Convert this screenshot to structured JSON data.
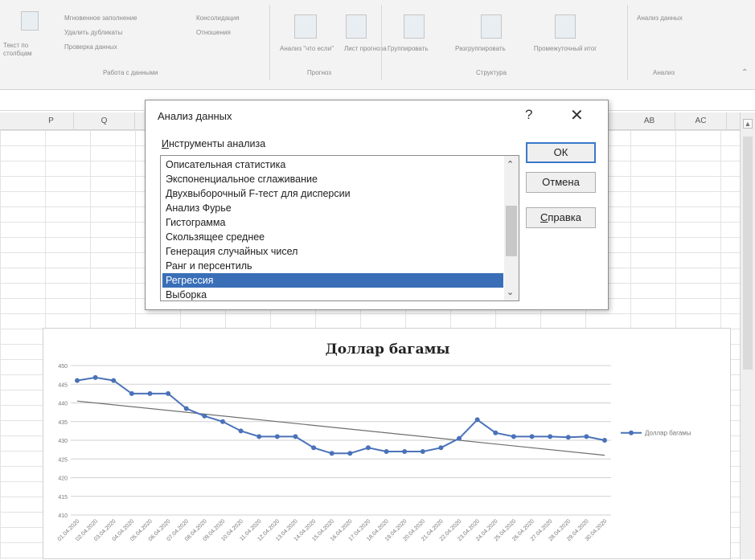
{
  "ribbon": {
    "groups": [
      {
        "label": "Работа с данными",
        "items": [
          "Текст по столбцам",
          "Мгновенное заполнение",
          "Удалить дубликаты",
          "Проверка данных",
          "Консолидация",
          "Отношения"
        ]
      },
      {
        "label": "Прогноз",
        "items": [
          "Анализ \"что если\"",
          "Лист прогноза"
        ]
      },
      {
        "label": "Структура",
        "items": [
          "Группировать",
          "Разгруппировать",
          "Промежуточный итог"
        ]
      },
      {
        "label": "Анализ",
        "items": [
          "Анализ данных"
        ]
      }
    ]
  },
  "columns": [
    "P",
    "Q",
    "AB",
    "AC"
  ],
  "dialog": {
    "title": "Анализ данных",
    "help_glyph": "?",
    "close_glyph": "✕",
    "tools_label_underlined": "И",
    "tools_label_rest": "нструменты анализа",
    "items": [
      "Описательная статистика",
      "Экспоненциальное сглаживание",
      "Двухвыборочный F-тест для дисперсии",
      "Анализ Фурье",
      "Гистограмма",
      "Скользящее среднее",
      "Генерация случайных чисел",
      "Ранг и персентиль",
      "Регрессия",
      "Выборка"
    ],
    "selected_index": 8,
    "ok_label": "ОК",
    "cancel_label": "Отмена",
    "help_label_underlined": "С",
    "help_label_rest": "правка"
  },
  "chart_data": {
    "type": "line",
    "title": "Доллар багамы",
    "ylim": [
      410,
      450
    ],
    "yticks": [
      "410",
      "415",
      "420",
      "425",
      "430",
      "435",
      "440",
      "445",
      "450"
    ],
    "categories": [
      "01.04.2020",
      "02.04.2020",
      "03.04.2020",
      "04.04.2020",
      "05.04.2020",
      "06.04.2020",
      "07.04.2020",
      "08.04.2020",
      "09.04.2020",
      "10.04.2020",
      "11.04.2020",
      "12.04.2020",
      "13.04.2020",
      "14.04.2020",
      "15.04.2020",
      "16.04.2020",
      "17.04.2020",
      "18.04.2020",
      "19.04.2020",
      "20.04.2020",
      "21.04.2020",
      "22.04.2020",
      "23.04.2020",
      "24.04.2020",
      "25.04.2020",
      "26.04.2020",
      "27.04.2020",
      "28.04.2020",
      "29.04.2020",
      "30.04.2020"
    ],
    "series": [
      {
        "name": "Доллар багамы",
        "values": [
          446,
          446.8,
          446,
          442.5,
          442.5,
          442.5,
          438.5,
          436.5,
          435,
          432.5,
          431,
          431,
          431,
          428,
          426.5,
          426.5,
          428,
          427,
          427,
          427,
          428,
          430.5,
          435.5,
          432,
          431,
          431,
          431,
          430.8,
          431,
          430
        ]
      }
    ],
    "trendline": {
      "start": 440.5,
      "end": 426
    },
    "grid": true,
    "legend": "right",
    "colors": {
      "series": "#4a72b8",
      "trend": "#6e6e6e"
    }
  }
}
